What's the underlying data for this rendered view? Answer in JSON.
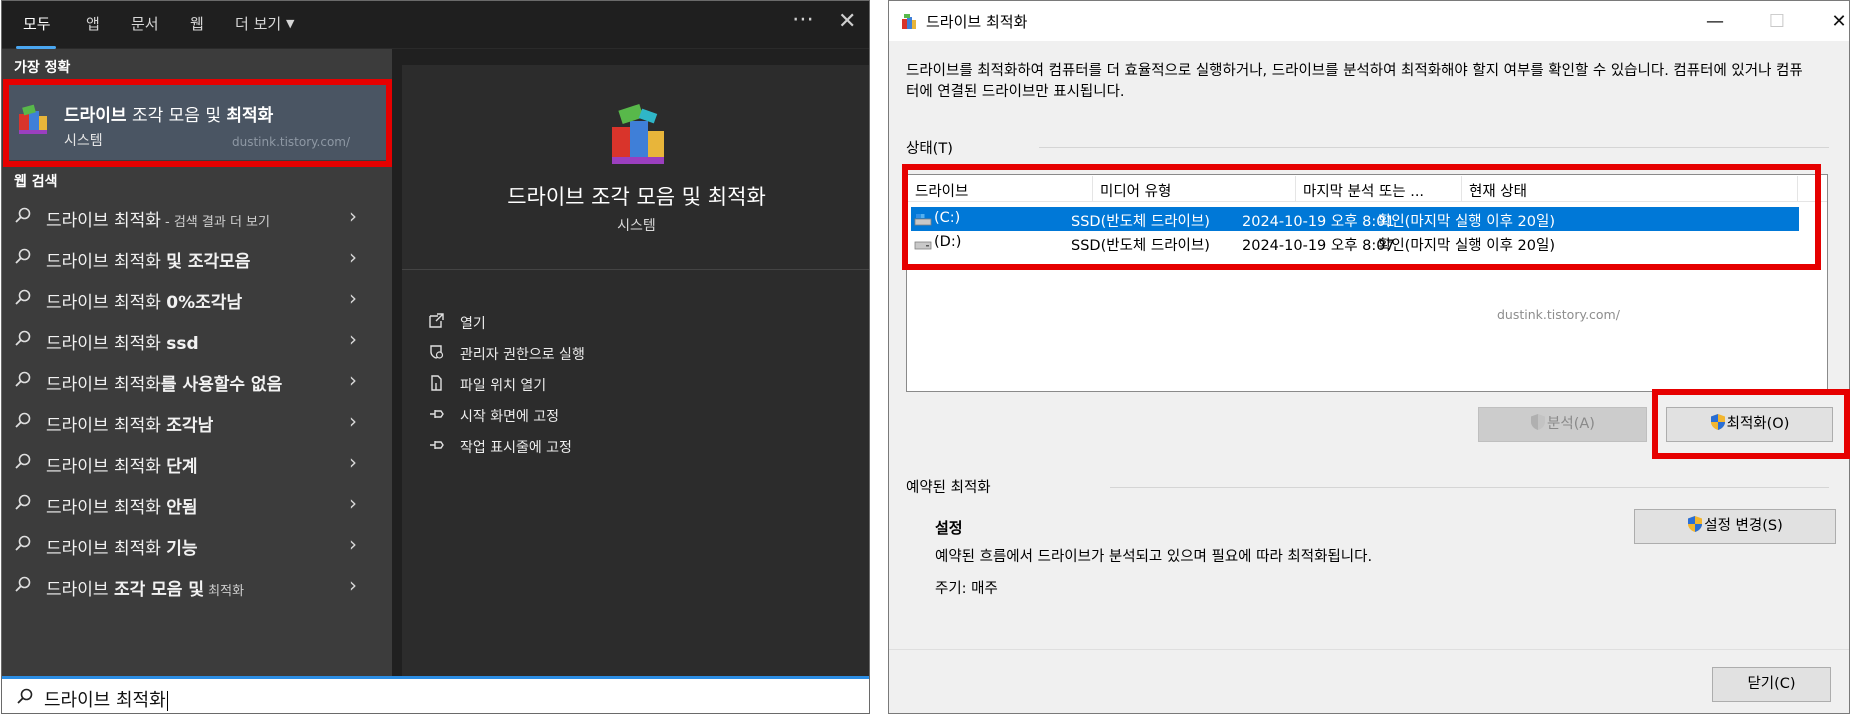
{
  "search": {
    "tabs": [
      "모두",
      "앱",
      "문서",
      "웹",
      "더 보기"
    ],
    "more_icon": "ellipsis-icon",
    "close_icon": "close-icon",
    "best_match_label": "가장 정확",
    "best_match": {
      "title_bold1": "드라이브",
      "title_mid": " 조각 모음 및 ",
      "title_bold2": "최적화",
      "subtitle": "시스템",
      "watermark": "dustink.tistory.com/"
    },
    "web_label": "웹 검색",
    "web_items": [
      {
        "text": "드라이브 최적화",
        "bold": "",
        "suffix": " - 검색 결과 더 보기"
      },
      {
        "text": "드라이브 최적화 ",
        "bold": "및 조각모음",
        "suffix": ""
      },
      {
        "text": "드라이브 최적화 ",
        "bold": "0%조각남",
        "suffix": ""
      },
      {
        "text": "드라이브 최적화 ",
        "bold": "ssd",
        "suffix": ""
      },
      {
        "text": "드라이브 최적화",
        "bold": "를 사용할수 없음",
        "suffix": ""
      },
      {
        "text": "드라이브 최적화 ",
        "bold": "조각남",
        "suffix": ""
      },
      {
        "text": "드라이브 최적화 ",
        "bold": "단계",
        "suffix": ""
      },
      {
        "text": "드라이브 최적화 ",
        "bold": "안됨",
        "suffix": ""
      },
      {
        "text": "드라이브 최적화 ",
        "bold": "기능",
        "suffix": ""
      },
      {
        "text": "드라이브 ",
        "bold": "조각 모음 및",
        "suffix": " 최적화"
      }
    ],
    "preview": {
      "title": "드라이브 조각 모음 및 최적화",
      "subtitle": "시스템",
      "actions": [
        {
          "label": "열기",
          "icon": "open-icon"
        },
        {
          "label": "관리자 권한으로 실행",
          "icon": "admin-shield-icon"
        },
        {
          "label": "파일 위치 열기",
          "icon": "file-location-icon"
        },
        {
          "label": "시작 화면에 고정",
          "icon": "pin-icon"
        },
        {
          "label": "작업 표시줄에 고정",
          "icon": "pin-icon"
        }
      ]
    },
    "query": "드라이브 최적화"
  },
  "dialog": {
    "title": "드라이브 최적화",
    "description": "드라이브를 최적화하여 컴퓨터를 더 효율적으로 실행하거나, 드라이브를 분석하여 최적화해야 할지 여부를 확인할 수 있습니다. 컴퓨터에 있거나 컴퓨터에 연결된 드라이브만 표시됩니다.",
    "status_label": "상태(T)",
    "columns": [
      "드라이브",
      "미디어 유형",
      "마지막 분석 또는 ...",
      "현재 상태"
    ],
    "rows": [
      {
        "drive": "(C:)",
        "media": "SSD(반도체 드라이브)",
        "last": "2024-10-19 오후 8:01",
        "status": "확인(마지막 실행 이후 20일)"
      },
      {
        "drive": "(D:)",
        "media": "SSD(반도체 드라이브)",
        "last": "2024-10-19 오후 8:07",
        "status": "확인(마지막 실행 이후 20일)"
      }
    ],
    "selected_row": 0,
    "watermark": "dustink.tistory.com/",
    "analyze_button": "분석(A)",
    "optimize_button": "최적화(O)",
    "scheduled_label": "예약된 최적화",
    "settings_heading": "설정",
    "settings_desc": "예약된 흐름에서 드라이브가 분석되고 있으며 필요에 따라 최적화됩니다.",
    "frequency": "주기: 매주",
    "change_settings_button": "설정 변경(S)",
    "close_button": "닫기(C)"
  },
  "colors": {
    "highlight_red": "#e60000",
    "selection_blue": "#0078d7",
    "search_accent": "#2b8de4"
  }
}
